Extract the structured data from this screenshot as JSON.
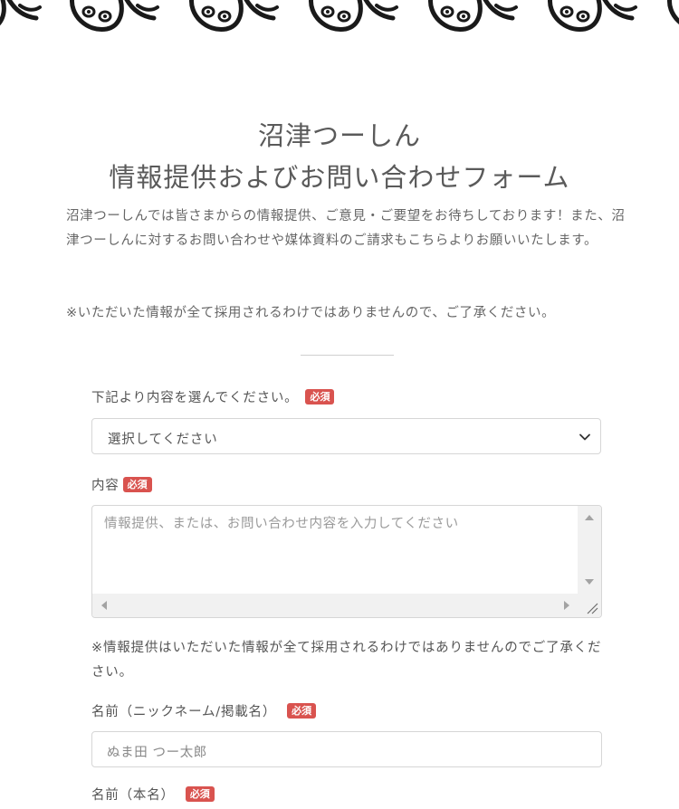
{
  "header": {
    "title_line1": "沼津つーしん",
    "title_line2": "情報提供およびお問い合わせフォーム"
  },
  "intro": {
    "text": "沼津つーしんでは皆さまからの情報提供、ご意見・ご要望をお待ちしております！また、沼津つーしんに対するお問い合わせや媒体資料のご請求もこちらよりお願いいたします。",
    "notice": "※いただいた情報が全て採用されるわけではありませんので、ご了承ください。"
  },
  "form": {
    "required_badge": "必須",
    "category": {
      "label": "下記より内容を選んでください。",
      "selected": "選択してください"
    },
    "content": {
      "label": "内容",
      "placeholder": "情報提供、または、お問い合わせ内容を入力してください",
      "note": "※情報提供はいただいた情報が全て採用されるわけではありませんのでご了承ください。"
    },
    "nickname": {
      "label": "名前（ニックネーム/掲載名）",
      "placeholder": "ぬま田 つー太郎"
    },
    "realname": {
      "label": "名前（本名）"
    }
  },
  "colors": {
    "badge": "#d9534f",
    "text": "#555555",
    "border": "#d6d6d6"
  },
  "icons": {
    "select_arrow": "chevron-down-icon",
    "scroll_up": "triangle-up-icon",
    "scroll_down": "triangle-down-icon",
    "scroll_left": "triangle-left-icon",
    "scroll_right": "triangle-right-icon",
    "resize": "resize-grip-icon"
  }
}
